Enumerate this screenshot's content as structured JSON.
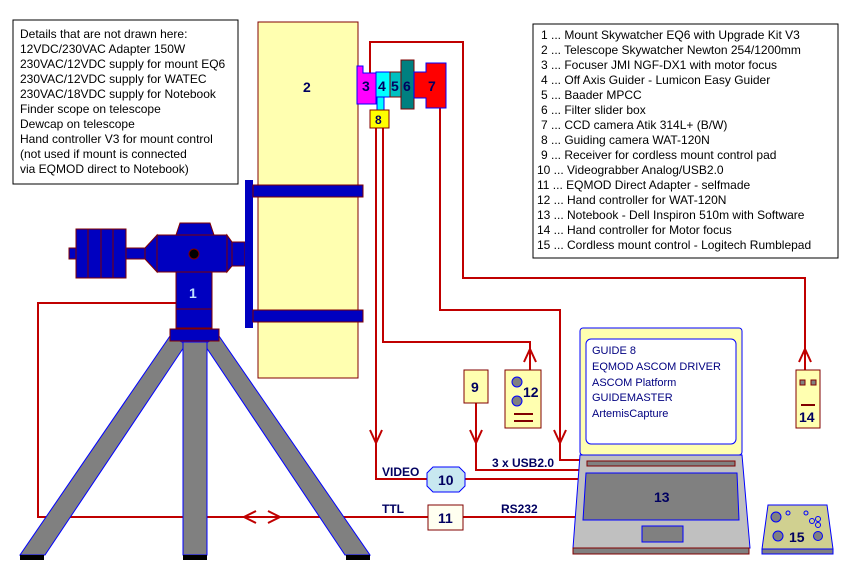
{
  "notes": {
    "lines": [
      "Details that are not drawn here:",
      "12VDC/230VAC Adapter 150W",
      "230VAC/12VDC supply for mount EQ6",
      "230VAC/12VDC supply for WATEC",
      "230VAC/18VDC supply for Notebook",
      "Finder scope on telescope",
      "Dewcap on telescope",
      "Hand controller V3 for mount control",
      "(not used if mount is connected",
      "via EQMOD direct to Notebook)"
    ]
  },
  "legend": {
    "items": [
      "1 ... Mount Skywatcher EQ6 with Upgrade Kit V3",
      "2 ... Telescope Skywatcher Newton 254/1200mm",
      "3 ... Focuser JMI NGF-DX1 with motor focus",
      "4 ... Off Axis Guider - Lumicon Easy Guider",
      "5 ... Baader MPCC",
      "6 ... Filter slider box",
      "7 ... CCD camera Atik 314L+ (B/W)",
      "8 ... Guiding camera WAT-120N",
      "9 ... Receiver for cordless mount control pad",
      "10 ... Videograbber Analog/USB2.0",
      "11 ... EQMOD Direct Adapter - selfmade",
      "12 ... Hand controller for WAT-120N",
      "13 ... Notebook - Dell Inspiron 510m with Software",
      "14 ... Hand controller for Motor focus",
      "15 ... Cordless mount control - Logitech Rumblepad"
    ]
  },
  "components": {
    "n1": "1",
    "n2": "2",
    "n3": "3",
    "n4": "4",
    "n5": "5",
    "n6": "6",
    "n7": "7",
    "n8": "8",
    "n9": "9",
    "n10": "10",
    "n11": "11",
    "n12": "12",
    "n13": "13",
    "n14": "14",
    "n15": "15"
  },
  "wires": {
    "video": "VIDEO",
    "usb": "3 x USB2.0",
    "ttl": "TTL",
    "rs232": "RS232"
  },
  "software": [
    "GUIDE 8",
    "EQMOD ASCOM DRIVER",
    "ASCOM Platform",
    "GUIDEMASTER",
    "ArtemisCapture"
  ],
  "colors": {
    "wire": "#c00000",
    "mount": "#0000c0",
    "tube": "#ffffb0",
    "tripod": "#808080"
  }
}
